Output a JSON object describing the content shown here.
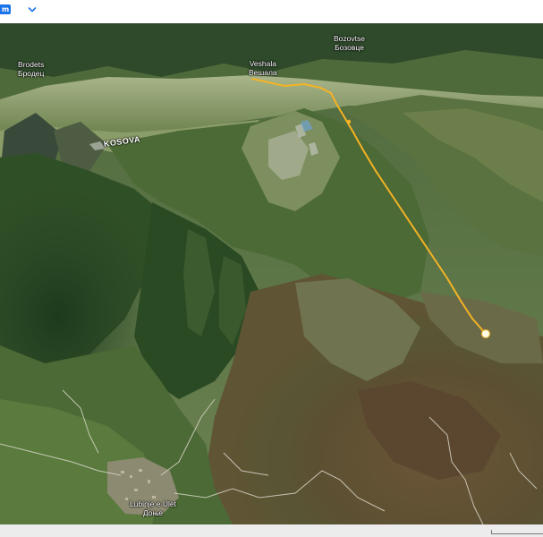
{
  "toolbar": {
    "button_glyph": "m",
    "chevron_icon": "chevron-down-icon"
  },
  "map": {
    "region_label": "KOSOVA",
    "places": {
      "brodets": {
        "latin": "Brodets",
        "cyrillic": "Бродец"
      },
      "veshala": {
        "latin": "Veshala",
        "cyrillic": "Вешала"
      },
      "bozovtse": {
        "latin": "Bozovtse",
        "cyrillic": "Бозовце"
      },
      "lubinje": {
        "latin": "Lubinje e Ulet",
        "cyrillic": "Доње"
      }
    },
    "route": {
      "color": "#f5b324",
      "end_marker_color": "#fffbe6"
    }
  }
}
